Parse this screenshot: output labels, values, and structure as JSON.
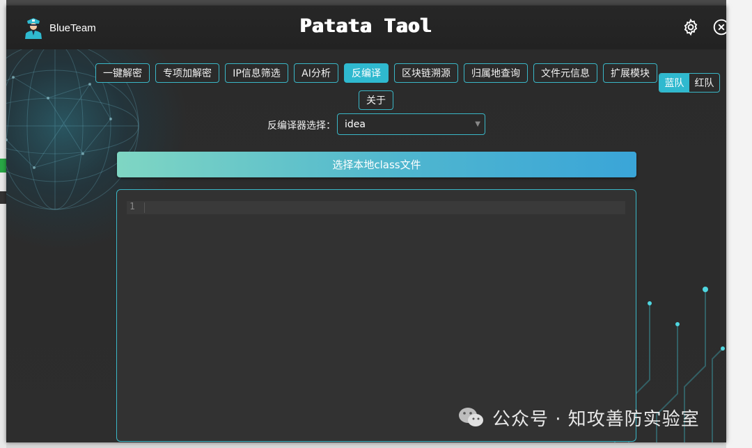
{
  "app": {
    "brand_name": "BlueTeam",
    "title": "Patata Taol"
  },
  "titlebar": {
    "icons": [
      "settings-icon",
      "close-icon"
    ]
  },
  "nav": {
    "tabs": [
      {
        "label": "一键解密"
      },
      {
        "label": "专项加解密"
      },
      {
        "label": "IP信息筛选"
      },
      {
        "label": "AI分析"
      },
      {
        "label": "反编译",
        "active": true
      },
      {
        "label": "区块链溯源"
      },
      {
        "label": "归属地查询"
      },
      {
        "label": "文件元信息"
      },
      {
        "label": "扩展模块"
      },
      {
        "label": "关于"
      }
    ]
  },
  "team": {
    "blue": "蓝队",
    "red": "红队",
    "selected": "蓝队"
  },
  "decompiler": {
    "label": "反编译器选择：",
    "selected": "idea"
  },
  "choose_file": {
    "label": "选择本地class文件"
  },
  "editor": {
    "line_number": "1"
  },
  "watermark": {
    "text": "公众号 · 知攻善防实验室"
  },
  "colors": {
    "accent": "#2fb9cf",
    "window_bg": "#2d2d2d",
    "titlebar_bg": "#232323"
  }
}
